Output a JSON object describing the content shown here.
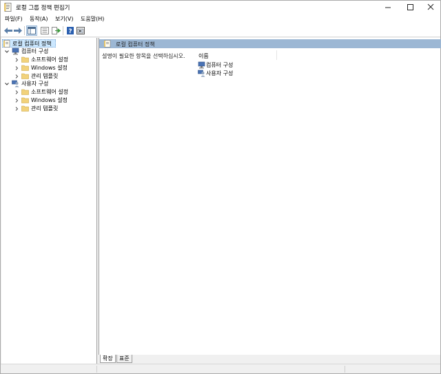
{
  "window": {
    "title": "로컬 그룹 정책 편집기",
    "controls": {
      "minimize": "—",
      "maximize": "☐",
      "close": "✕"
    }
  },
  "menu": [
    "파일(F)",
    "동작(A)",
    "보기(V)",
    "도움말(H)"
  ],
  "toolbar": {
    "buttons": [
      "back-icon",
      "forward-icon",
      "show-tree-icon",
      "properties-icon",
      "export-icon",
      "help-icon",
      "view-icon"
    ]
  },
  "tree": {
    "root": "로컬 컴퓨터 정책",
    "nodes": [
      {
        "label": "컴퓨터 구성",
        "expanded": true,
        "children": [
          "소프트웨어 설정",
          "Windows 설정",
          "관리 템플릿"
        ]
      },
      {
        "label": "사용자 구성",
        "expanded": true,
        "children": [
          "소프트웨어 설정",
          "Windows 설정",
          "관리 템플릿"
        ]
      }
    ]
  },
  "content": {
    "header": "로컬 컴퓨터 정책",
    "description": "설명이 필요한 항목을 선택하십시오.",
    "column": "이름",
    "items": [
      "컴퓨터 구성",
      "사용자 구성"
    ]
  },
  "tabs": [
    "확장",
    "표준"
  ],
  "colors": {
    "header_band": "#9cb7d4",
    "selection": "#cce8ff",
    "folder": "#f2d27a"
  }
}
